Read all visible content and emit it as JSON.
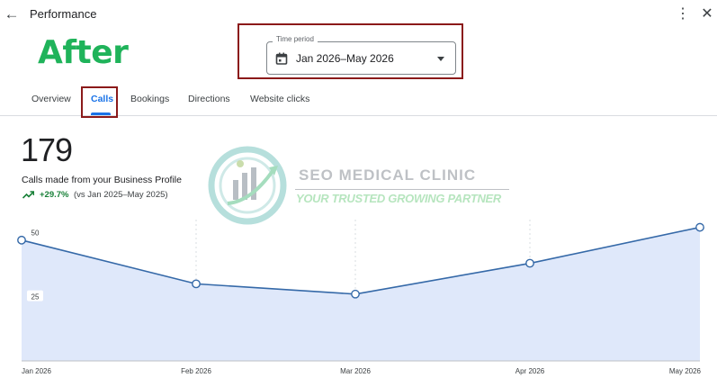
{
  "header": {
    "title": "Performance",
    "back_icon": "arrow-back-icon",
    "more_icon": "more-vert-icon",
    "close_icon": "close-icon"
  },
  "overlay": {
    "after_label": "After",
    "after_color": "#1fb35a",
    "highlight_color": "#8b1a1a"
  },
  "time_period": {
    "legend": "Time period",
    "value": "Jan 2026–May 2026",
    "icon": "calendar-icon"
  },
  "tabs": [
    {
      "label": "Overview",
      "active": false
    },
    {
      "label": "Calls",
      "active": true
    },
    {
      "label": "Bookings",
      "active": false
    },
    {
      "label": "Directions",
      "active": false
    },
    {
      "label": "Website clicks",
      "active": false
    }
  ],
  "metric": {
    "value": "179",
    "label": "Calls made from your Business Profile",
    "change": "+29.7%",
    "comparison": "(vs Jan 2025–May 2025)",
    "trend_icon": "trending-up-icon",
    "change_color": "#188038"
  },
  "watermark": {
    "title": "SEO MEDICAL CLINIC",
    "subtitle": "YOUR TRUSTED GROWING PARTNER"
  },
  "chart_data": {
    "type": "area",
    "categories": [
      "Jan 2026",
      "Feb 2026",
      "Mar 2026",
      "Apr 2026",
      "May 2026"
    ],
    "series": [
      {
        "values": [
          47,
          30,
          26,
          38,
          52
        ]
      }
    ],
    "y_ticks": [
      "50",
      "25"
    ],
    "ylim": [
      0,
      55
    ],
    "grid": "vertical dashed",
    "line_color": "#3569a8",
    "fill_color": "#dfe8fa"
  }
}
